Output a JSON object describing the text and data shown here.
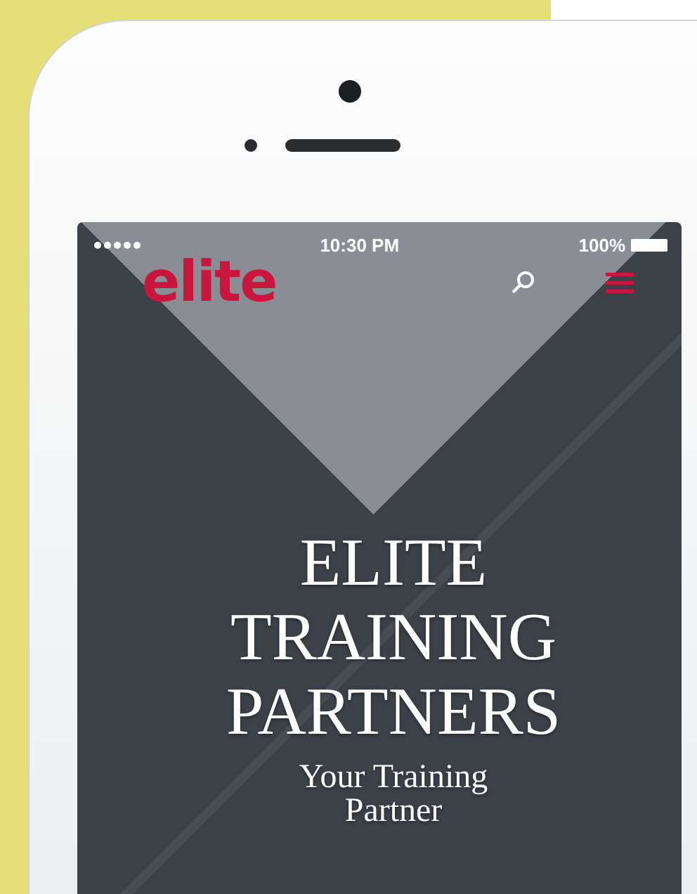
{
  "status_bar": {
    "time": "10:30 PM",
    "battery": "100%"
  },
  "header": {
    "logo": "elite"
  },
  "hero": {
    "title": "ELITE TRAINING PARTNERS",
    "subtitle": "Your Training Partner"
  }
}
